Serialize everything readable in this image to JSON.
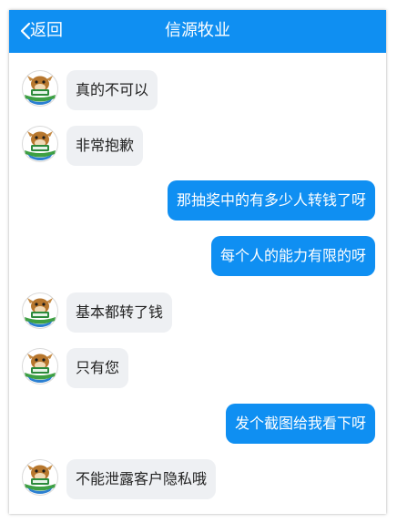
{
  "header": {
    "back_label": "返回",
    "title": "信源牧业",
    "color": "#0f8ff2"
  },
  "messages": [
    {
      "side": "received",
      "text": "真的不可以"
    },
    {
      "side": "received",
      "text": "非常抱歉"
    },
    {
      "side": "sent",
      "text": "那抽奖中的有多少人转钱了呀"
    },
    {
      "side": "sent",
      "text": "每个人的能力有限的呀"
    },
    {
      "side": "received",
      "text": "基本都转了钱"
    },
    {
      "side": "received",
      "text": "只有您"
    },
    {
      "side": "sent",
      "text": "发个截图给我看下呀"
    },
    {
      "side": "received",
      "text": "不能泄露客户隐私哦"
    }
  ],
  "colors": {
    "sent_bubble": "#0f8ff2",
    "received_bubble": "#eef0f3"
  }
}
